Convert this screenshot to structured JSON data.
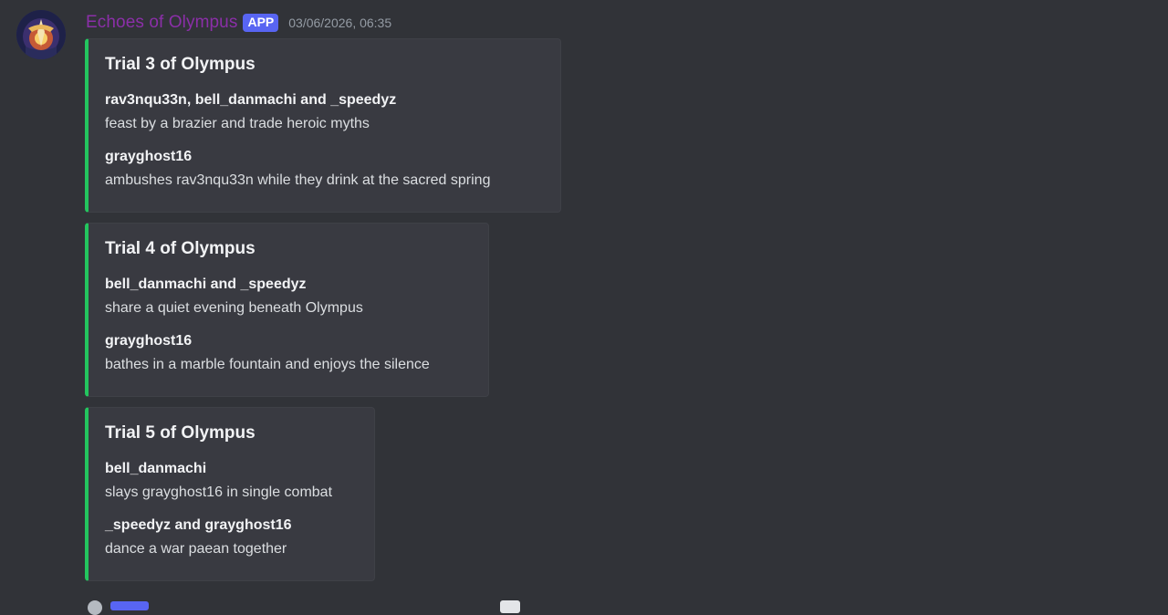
{
  "message": {
    "author": "Echoes of Olympus",
    "badge": "APP",
    "timestamp": "03/06/2026, 06:35",
    "avatar_icon": "olympus-avatar-icon",
    "accent_color": "#23c55e",
    "author_color": "#8b2fa8"
  },
  "embeds": [
    {
      "title": "Trial 3 of Olympus",
      "fields": [
        {
          "name": "rav3nqu33n, bell_danmachi and _speedyz",
          "value": "feast by a brazier and trade heroic myths"
        },
        {
          "name": "grayghost16",
          "value": "ambushes rav3nqu33n while they drink at the sacred spring"
        }
      ]
    },
    {
      "title": "Trial 4 of Olympus",
      "fields": [
        {
          "name": "bell_danmachi and _speedyz",
          "value": "share a quiet evening beneath Olympus"
        },
        {
          "name": "grayghost16",
          "value": "bathes in a marble fountain and enjoys the silence"
        }
      ]
    },
    {
      "title": "Trial 5 of Olympus",
      "fields": [
        {
          "name": "bell_danmachi",
          "value": "slays grayghost16 in single combat"
        },
        {
          "name": "_speedyz and grayghost16",
          "value": "dance a war paean together"
        }
      ]
    }
  ]
}
